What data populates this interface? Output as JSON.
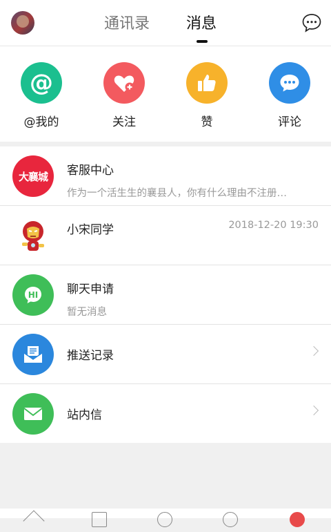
{
  "header": {
    "tabs": [
      {
        "label": "通讯录",
        "active": false
      },
      {
        "label": "消息",
        "active": true
      }
    ],
    "avatar_icon": "user-avatar",
    "chat_icon": "chat-bubble-icon"
  },
  "quick_actions": [
    {
      "label": "@我的",
      "icon": "at-icon",
      "color": "#1bbf8f"
    },
    {
      "label": "关注",
      "icon": "heart-plus-icon",
      "color": "#f35a5f"
    },
    {
      "label": "赞",
      "icon": "thumbs-up-icon",
      "color": "#f7b22b"
    },
    {
      "label": "评论",
      "icon": "comment-icon",
      "color": "#2f8ee6"
    }
  ],
  "messages": [
    {
      "title": "客服中心",
      "subtitle": "作为一个活生生的襄县人，你有什么理由不注册…",
      "logo_text": "大襄城",
      "color": "#e8263d"
    },
    {
      "title": "小宋同学",
      "time": "2018-12-20 19:30",
      "icon": "ironman-avatar"
    },
    {
      "title": "聊天申请",
      "subtitle": "暂无消息",
      "logo_text": "HI",
      "color": "#3fbe58"
    },
    {
      "title": "推送记录",
      "icon": "inbox-icon",
      "color": "#2b87dd"
    },
    {
      "title": "站内信",
      "icon": "mail-icon",
      "color": "#3fbe58"
    }
  ]
}
